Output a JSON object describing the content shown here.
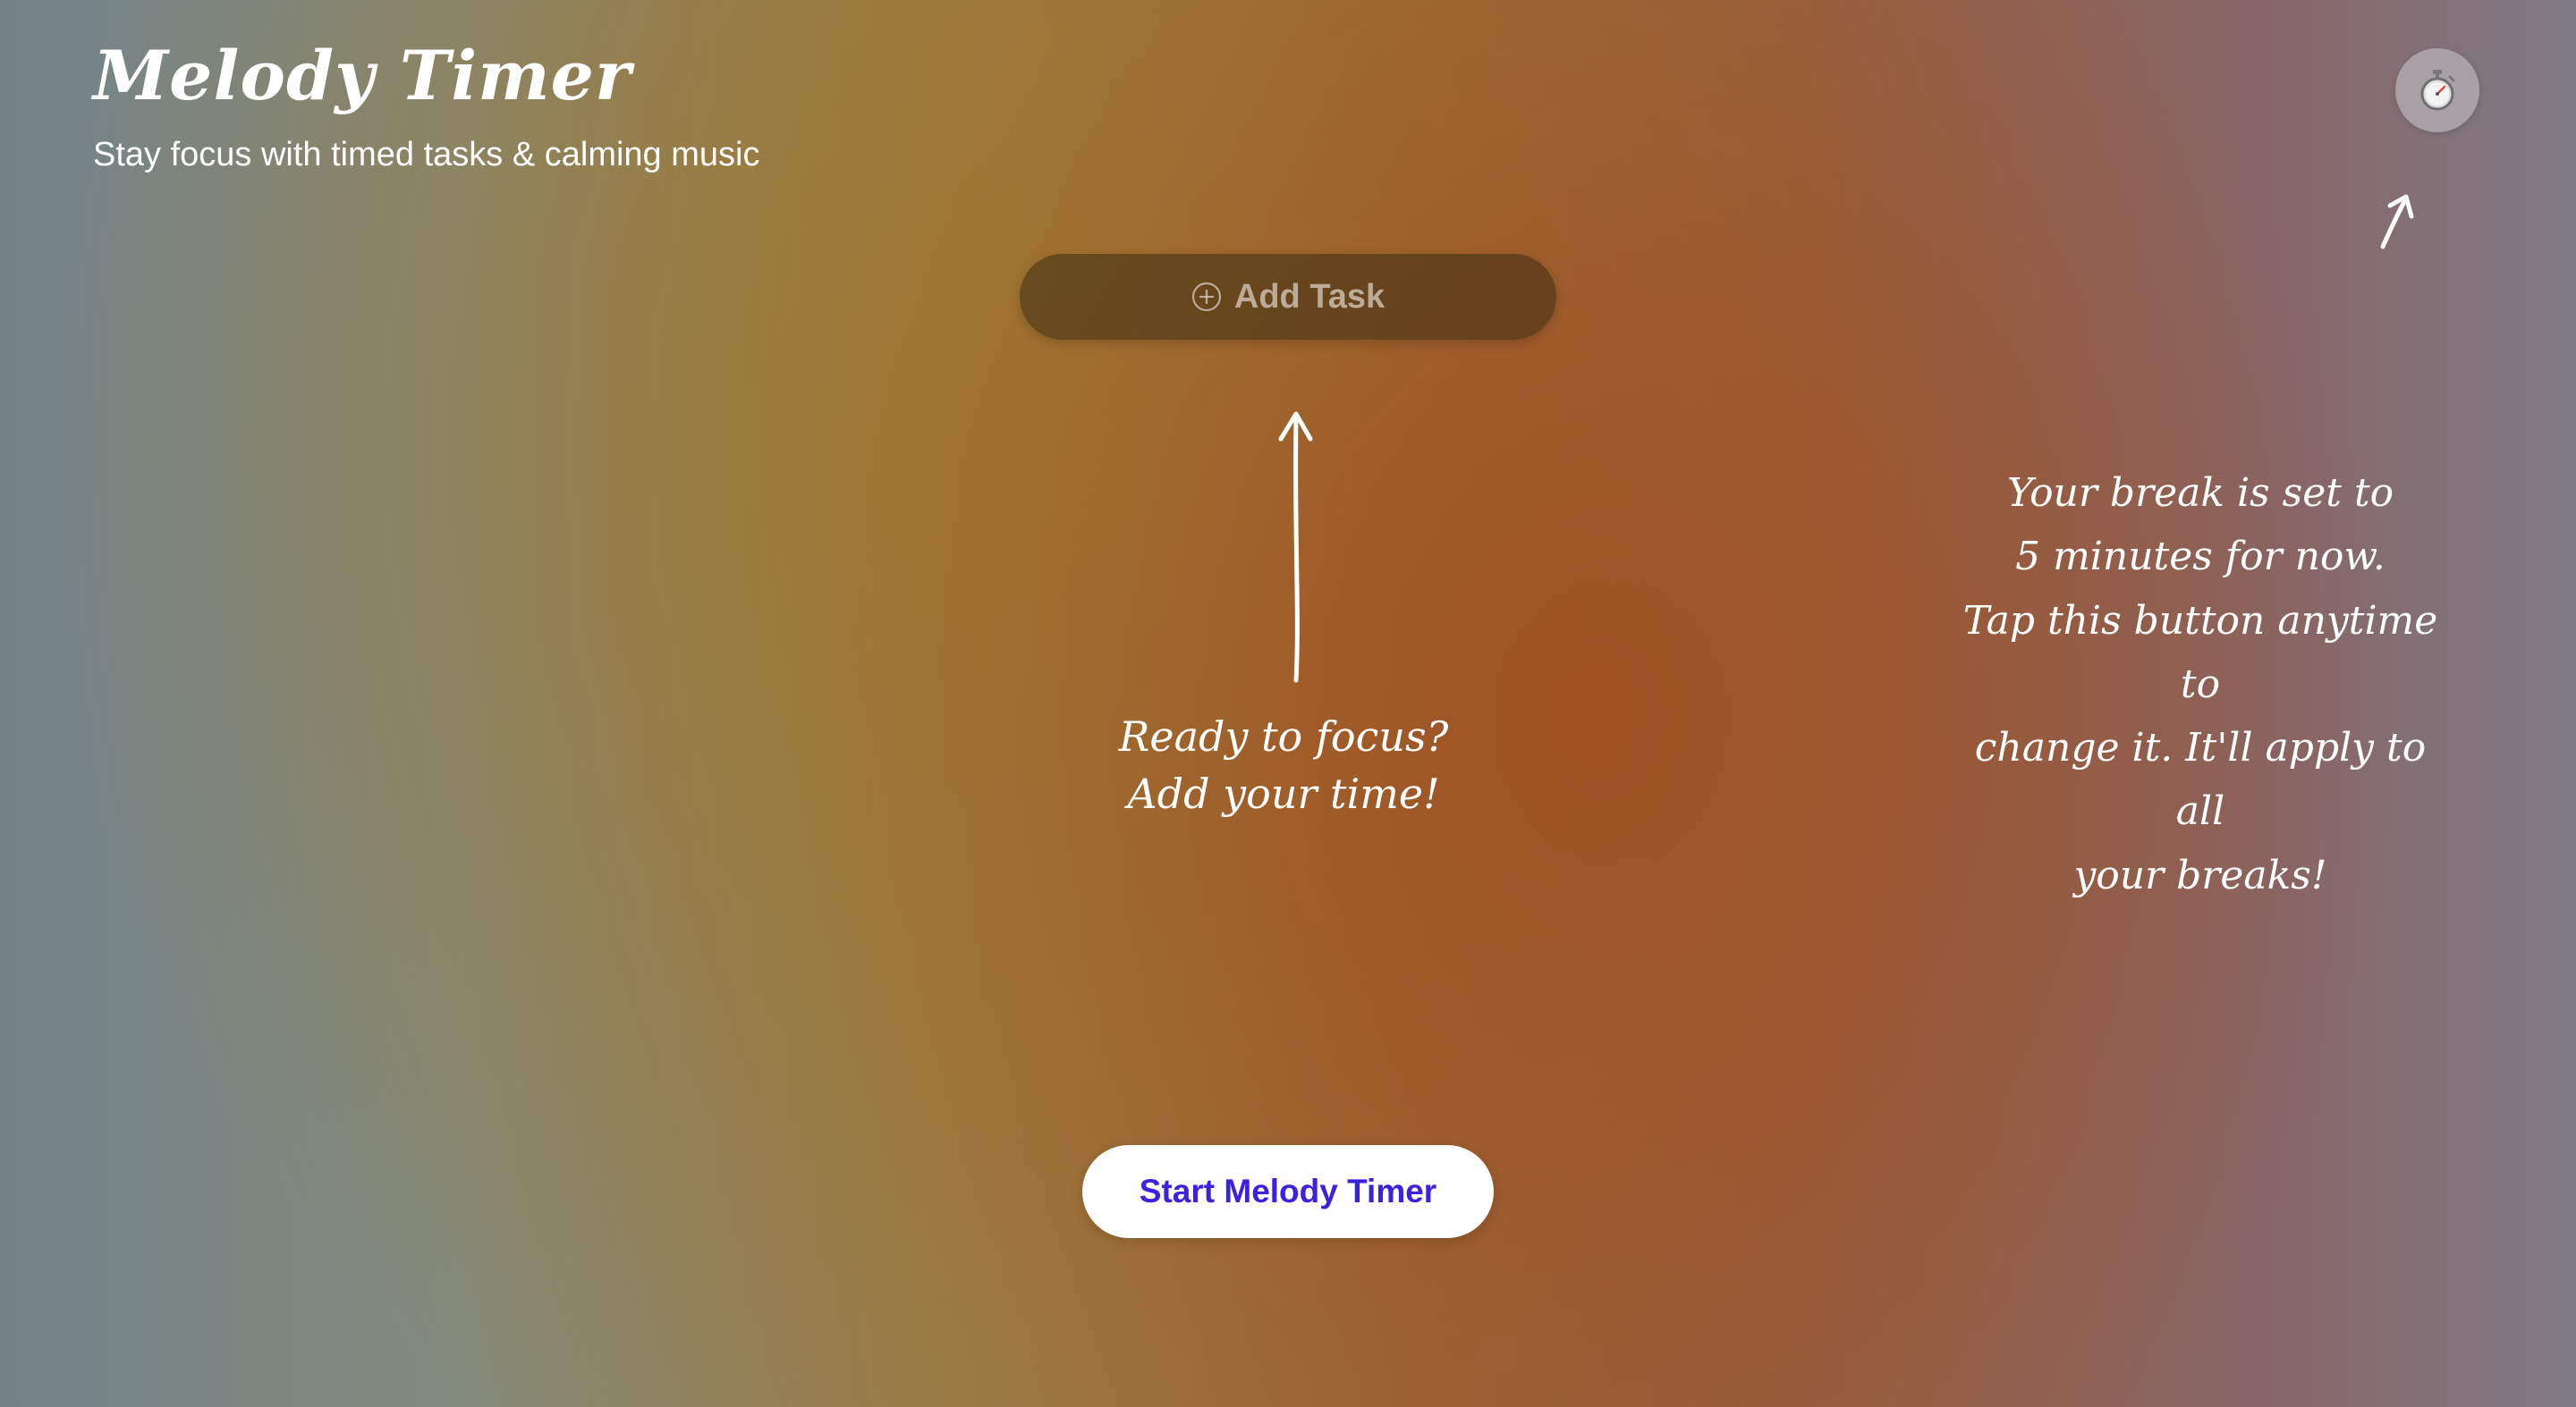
{
  "header": {
    "title": "Melody Timer",
    "subtitle": "Stay focus with timed tasks & calming music"
  },
  "add_task": {
    "label": "Add Task",
    "icon": "plus-circle-icon"
  },
  "hints": {
    "focus_line1": "Ready to focus?",
    "focus_line2": "Add your time!",
    "break_line1": "Your break is set to",
    "break_line2": "5 minutes for now.",
    "break_line3": "Tap this button anytime to",
    "break_line4": "change it. It'll apply to all",
    "break_line5": "your breaks!"
  },
  "break_timer_button": {
    "icon": "stopwatch-icon"
  },
  "start_button": {
    "label": "Start Melody Timer"
  },
  "colors": {
    "accent": "#3a22e0",
    "text": "#ffffff"
  }
}
